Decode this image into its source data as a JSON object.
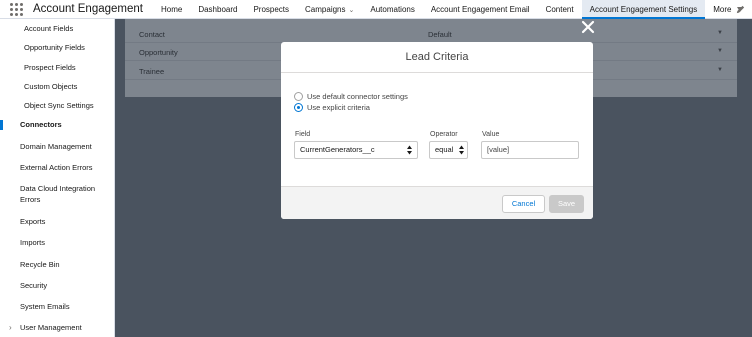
{
  "app": {
    "name": "Account Engagement"
  },
  "nav": {
    "items": [
      {
        "label": "Home"
      },
      {
        "label": "Dashboard"
      },
      {
        "label": "Prospects"
      },
      {
        "label": "Campaigns"
      },
      {
        "label": "Automations"
      },
      {
        "label": "Account Engagement Email"
      },
      {
        "label": "Content"
      },
      {
        "label": "Account Engagement Settings"
      },
      {
        "label": "More"
      }
    ]
  },
  "sidebar": {
    "items": [
      {
        "label": "Account Fields"
      },
      {
        "label": "Opportunity Fields"
      },
      {
        "label": "Prospect Fields"
      },
      {
        "label": "Custom Objects"
      },
      {
        "label": "Object Sync Settings"
      },
      {
        "label": "Connectors"
      },
      {
        "label": "Domain Management"
      },
      {
        "label": "External Action Errors"
      },
      {
        "label": "Data Cloud Integration"
      },
      {
        "label": "Errors"
      },
      {
        "label": "Exports"
      },
      {
        "label": "Imports"
      },
      {
        "label": "Recycle Bin"
      },
      {
        "label": "Security"
      },
      {
        "label": "System Emails"
      },
      {
        "label": "User Management"
      }
    ]
  },
  "background_table": {
    "rows": [
      {
        "object": "Contact",
        "value": "Default"
      },
      {
        "object": "Opportunity",
        "value": ""
      },
      {
        "object": "Trainee",
        "value": ""
      }
    ]
  },
  "modal": {
    "title": "Lead Criteria",
    "options": [
      {
        "label": "Use default connector settings",
        "checked": false
      },
      {
        "label": "Use explicit criteria",
        "checked": true
      }
    ],
    "field_label": "Field",
    "field_value": "CurrentGenerators__c",
    "operator_label": "Operator",
    "operator_value": "equal",
    "value_label": "Value",
    "value_value": "[value]",
    "cancel_label": "Cancel",
    "save_label": "Save"
  },
  "colors": {
    "brand": "#0176d3",
    "overlay": "#4e5661"
  }
}
